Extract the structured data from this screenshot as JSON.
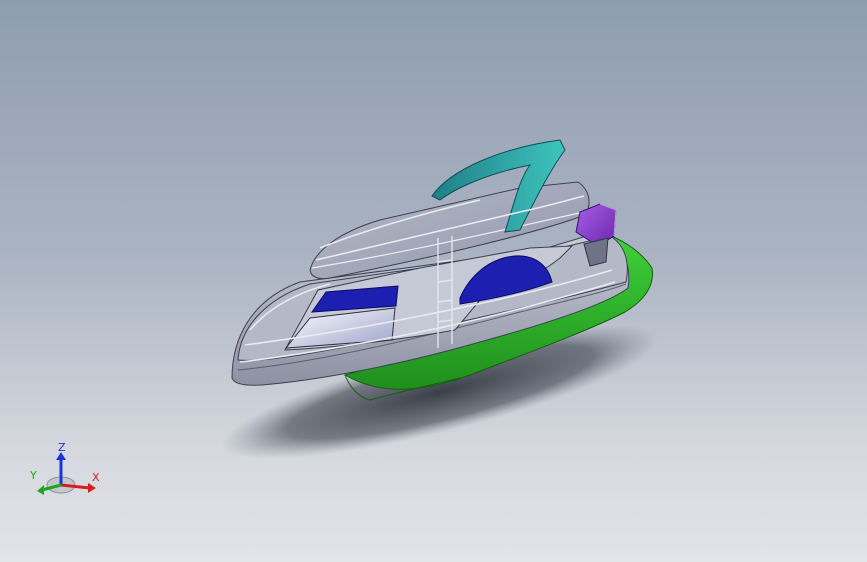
{
  "viewport": {
    "background_top": "#8f9db1",
    "background_bottom": "#e3e4e8"
  },
  "model": {
    "parts": [
      {
        "name": "hull-bottom",
        "color": "#2fbf2a"
      },
      {
        "name": "hull-side",
        "color": "#aeb4c4"
      },
      {
        "name": "cabin-windows",
        "color": "#1d1fb0"
      },
      {
        "name": "canopy",
        "color": "#2aa6a3"
      },
      {
        "name": "outboard-motor",
        "color": "#8a3fd1"
      }
    ]
  },
  "triad": {
    "axes": [
      {
        "label": "Z",
        "color": "#1c33d6"
      },
      {
        "label": "Y",
        "color": "#1fa51f"
      },
      {
        "label": "X",
        "color": "#d42020"
      }
    ]
  }
}
